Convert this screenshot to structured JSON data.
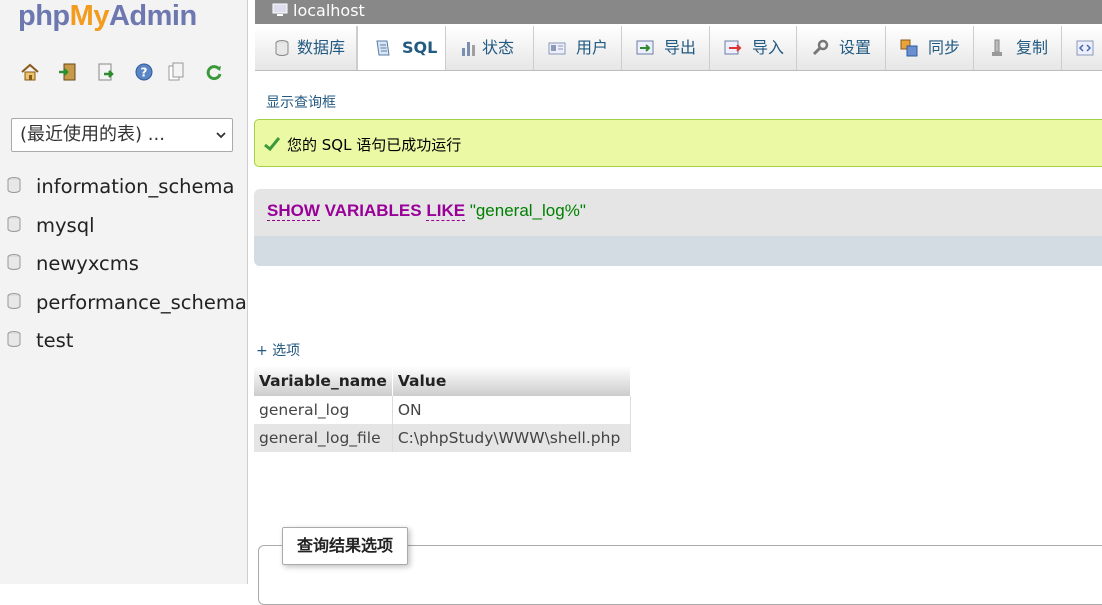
{
  "sidebar": {
    "logo": {
      "php": "php",
      "my": "My",
      "admin": "Admin"
    },
    "quick_icons": [
      "home-icon",
      "logout-icon",
      "query-window-icon",
      "help-icon",
      "docs-icon",
      "reload-icon"
    ],
    "db_select": {
      "value": "(最近使用的表) ..."
    },
    "databases": [
      "information_schema",
      "mysql",
      "newyxcms",
      "performance_schema",
      "test"
    ]
  },
  "server_bar": {
    "title": "localhost"
  },
  "tabs": [
    {
      "label": "数据库",
      "icon": "database-icon"
    },
    {
      "label": "SQL",
      "icon": "sql-icon",
      "active": true
    },
    {
      "label": "状态",
      "icon": "status-icon"
    },
    {
      "label": "用户",
      "icon": "users-icon"
    },
    {
      "label": "导出",
      "icon": "export-icon"
    },
    {
      "label": "导入",
      "icon": "import-icon"
    },
    {
      "label": "设置",
      "icon": "settings-icon"
    },
    {
      "label": "同步",
      "icon": "sync-icon"
    },
    {
      "label": "复制",
      "icon": "replication-icon"
    }
  ],
  "main": {
    "show_query": "显示查询框",
    "success_message": "您的 SQL 语句已成功运行",
    "sql": {
      "kw1": "SHOW",
      "kw2": "VARIABLES",
      "kw3": "LIKE",
      "string": "\"general_log%\""
    },
    "options_link": "+ 选项",
    "result": {
      "columns": [
        "Variable_name",
        "Value"
      ],
      "rows": [
        [
          "general_log",
          "ON"
        ],
        [
          "general_log_file",
          "C:\\phpStudy\\WWW\\shell.php"
        ]
      ]
    },
    "query_results_legend": "查询结果选项"
  },
  "colors": {
    "link": "#235a81",
    "keyword": "#990099",
    "string": "#008000",
    "success_bg": "#ebf8a4"
  }
}
